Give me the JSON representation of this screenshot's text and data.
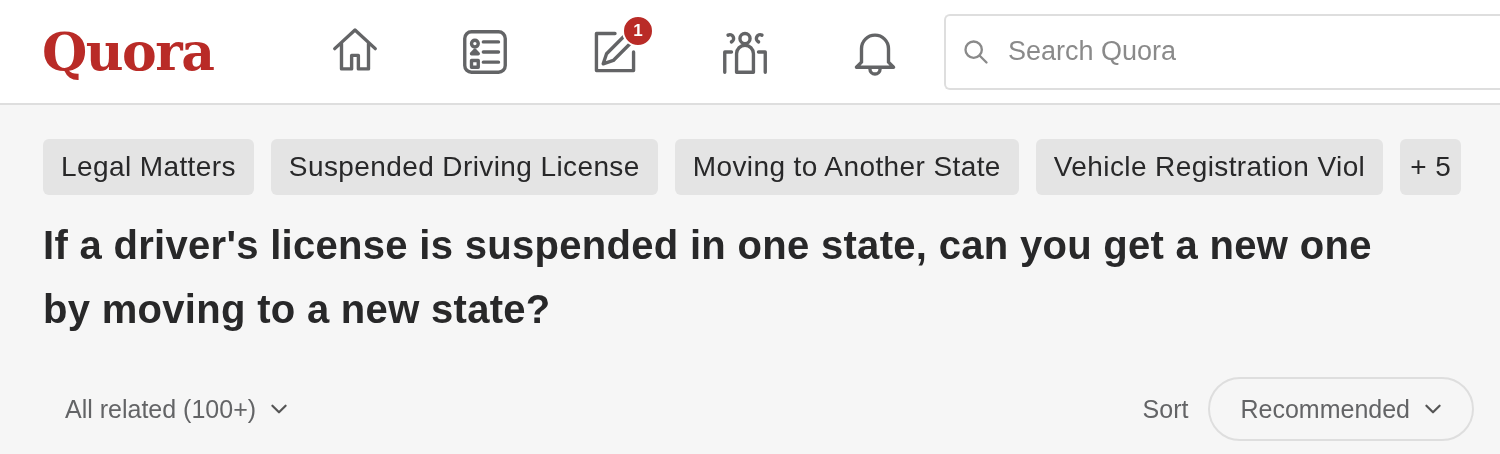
{
  "header": {
    "logo": "Quora",
    "nav": [
      {
        "kind": "home",
        "selected": false
      },
      {
        "kind": "list",
        "selected": false
      },
      {
        "kind": "write",
        "selected": false,
        "badge": "1"
      },
      {
        "kind": "spaces",
        "selected": false
      },
      {
        "kind": "bell",
        "selected": false
      }
    ],
    "search": {
      "placeholder": "Search Quora"
    }
  },
  "topics": [
    "Legal Matters",
    "Suspended Driving License",
    "Moving to Another State",
    "Vehicle Registration Viol"
  ],
  "more_topics": "+ 5",
  "question": "If a driver's license is suspended in one state, can you get a new one by moving to a new state?",
  "filter": {
    "label": "All related (100+)"
  },
  "sort": {
    "label": "Sort",
    "value": "Recommended"
  }
}
